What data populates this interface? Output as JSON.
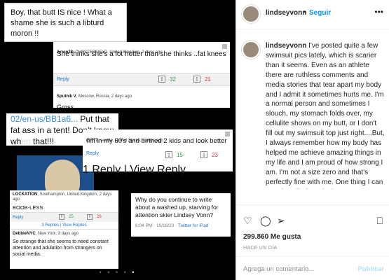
{
  "post": {
    "username": "lindseyvonn",
    "follow_label": "Seguir",
    "more_label": "•••",
    "separator": "•",
    "caption": "I've posted quite a few swimsuit pics lately, which is scarier than it seems. Even as an athlete there are ruthless comments and media stories that tear apart my body and I admit it sometimes hurts me. I'm a normal person and sometimes I slouch, my stomach folds over, my cellulite shows on my butt, or I don't fill out my swimsuit top just right....But, I always remember how my body has helped me achieve amazing things in my life and I am proud of how strong I am.  I'm not a size zero and that's perfectly fine with me. One thing I can promise all of you is that I never Photoshop my photos and am proud to officially never had any plastic surgery of any kind. No Botox, no fillers, no mini surgeries. Literally",
    "likes": "299.860 Me gusta",
    "time_ago": "HACE UN DÍA",
    "comment_placeholder": "Agrega un comentario...",
    "publish_label": "Publicar"
  },
  "icons": {
    "heart": "♡",
    "comment": "◯",
    "share": "➢",
    "bookmark": "⎕",
    "up_arrow": "⇧",
    "down_arrow": "⇩"
  },
  "collage": {
    "c1_text": "Boy, that butt IS nice ! What a shame she is such a libturd moron !!",
    "c2_meta_name": "Arron38",
    "c2_meta_rest": ", CHESTERFIELD, United Kingdom, 2 days ago",
    "c2_text": "She thinks she's a lot hotter than she thinks ..fat knees",
    "c2_reply": "Reply",
    "c2_up": "32",
    "c2_down": "21",
    "c3_meta_name": "Sputnik V",
    "c3_meta_rest": ", Moscow, Russia, 2 days ago",
    "c3_text": "Gross",
    "c4_url": "02/en-us/BB1a6...",
    "c4_text_a": " Put that fat ass in a tent! Don't know wh",
    "c4_blur": "en",
    "c4_text_b": " that!!!",
    "c5_meta_name": "cjj777",
    "c5_meta_rest": ", seattle, United States, 2 days ago",
    "c5_text": "I'm in my 60's and birthed 2 kids and look better",
    "c5_reply": "Reply",
    "c5_up": "15",
    "c5_down": "23",
    "c5_reply_line": "1 Reply | View Reply",
    "c6_meta_name": "LOCKATION",
    "c6_meta_rest": ", Southampton, United Kingdom, 2 days ago",
    "c6_text": "BOOB-LESS",
    "c6_reply": "Reply",
    "c6_up": "25",
    "c6_down": "26",
    "c6_replies": "3 Replies | View Replies",
    "c6b_meta_name": "DebbieNYC",
    "c6b_meta_rest": ", New York, 3 days ago",
    "c6b_text": "So strange that she seems to need constant attention and adulation from strangers on social media.",
    "c7_text": "Why do you continue to write about a washed up, starving for attention skier Lindsey Vonn?",
    "c7_time": "6:04 PM · 10/16/20 · ",
    "c7_source": "Twitter for iPad",
    "carousel_dots": "• • • •",
    "carousel_active": "•"
  }
}
